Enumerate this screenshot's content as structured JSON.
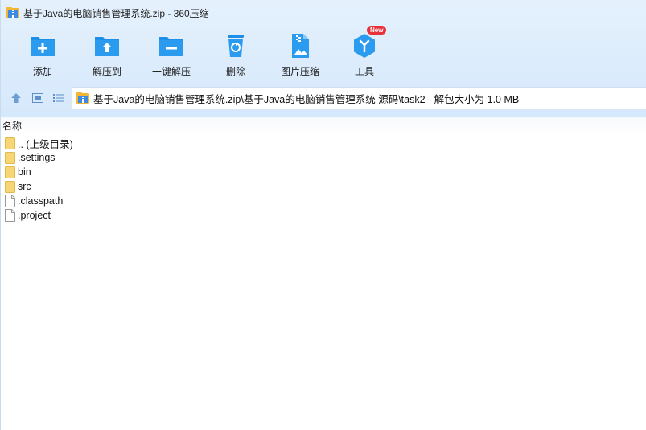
{
  "window": {
    "title": "基于Java的电脑销售管理系统.zip - 360压缩"
  },
  "toolbar": {
    "items": [
      {
        "label": "添加",
        "icon": "add-folder-icon"
      },
      {
        "label": "解压到",
        "icon": "extract-to-icon"
      },
      {
        "label": "一键解压",
        "icon": "one-click-extract-icon"
      },
      {
        "label": "删除",
        "icon": "delete-bin-icon"
      },
      {
        "label": "图片压缩",
        "icon": "image-compress-icon"
      },
      {
        "label": "工具",
        "icon": "tools-cube-icon",
        "badge": "New"
      }
    ]
  },
  "nav": {
    "up_icon": "up-arrow-icon",
    "view_icon": "thumbnail-view-icon",
    "list_icon": "list-view-icon"
  },
  "address": {
    "path": "基于Java的电脑销售管理系统.zip\\基于Java的电脑销售管理系统 源码\\task2 - 解包大小为 1.0 MB"
  },
  "list": {
    "header_name": "名称",
    "rows": [
      {
        "name": ".. (上级目录)",
        "type": "folder"
      },
      {
        "name": ".settings",
        "type": "folder"
      },
      {
        "name": "bin",
        "type": "folder"
      },
      {
        "name": "src",
        "type": "folder"
      },
      {
        "name": ".classpath",
        "type": "file"
      },
      {
        "name": ".project",
        "type": "file"
      }
    ]
  },
  "colors": {
    "accent_blue": "#1c8fe6",
    "toolbar_bg": "#dcecfc",
    "folder_yellow": "#f7d675",
    "badge_red": "#e8313a"
  }
}
